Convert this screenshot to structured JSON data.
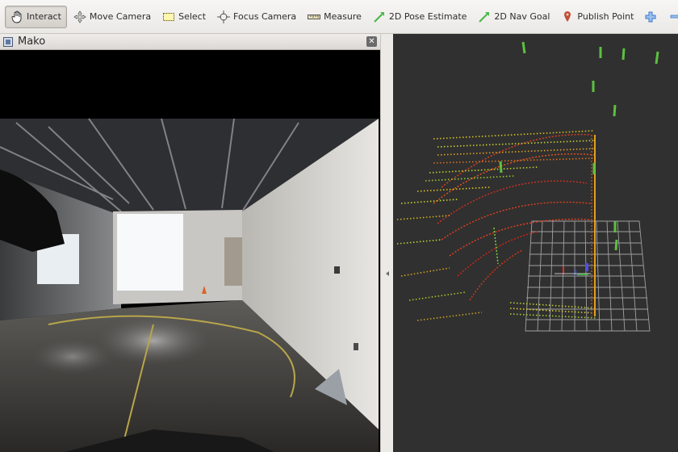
{
  "toolbar": {
    "tools": [
      {
        "label": "Interact",
        "icon": "hand-cursor-icon",
        "active": true
      },
      {
        "label": "Move Camera",
        "icon": "move-arrows-icon"
      },
      {
        "label": "Select",
        "icon": "select-rect-icon"
      },
      {
        "label": "Focus Camera",
        "icon": "focus-crosshair-icon"
      },
      {
        "label": "Measure",
        "icon": "ruler-icon"
      },
      {
        "label": "2D Pose Estimate",
        "icon": "green-arrow-icon"
      },
      {
        "label": "2D Nav Goal",
        "icon": "green-arrow-icon"
      },
      {
        "label": "Publish Point",
        "icon": "map-pin-icon"
      }
    ],
    "add_tool_icon": "plus-icon",
    "remove_tool_icon": "minus-icon",
    "accent_colors": {
      "pose_arrow": "#4cb84c",
      "pin": "#c0503a",
      "plus": "#3b78c9"
    }
  },
  "camera_panel": {
    "title": "Mako",
    "close_icon": "close-icon"
  },
  "view3d": {
    "background": "#303030",
    "grid_color": "#a0a0a0"
  }
}
